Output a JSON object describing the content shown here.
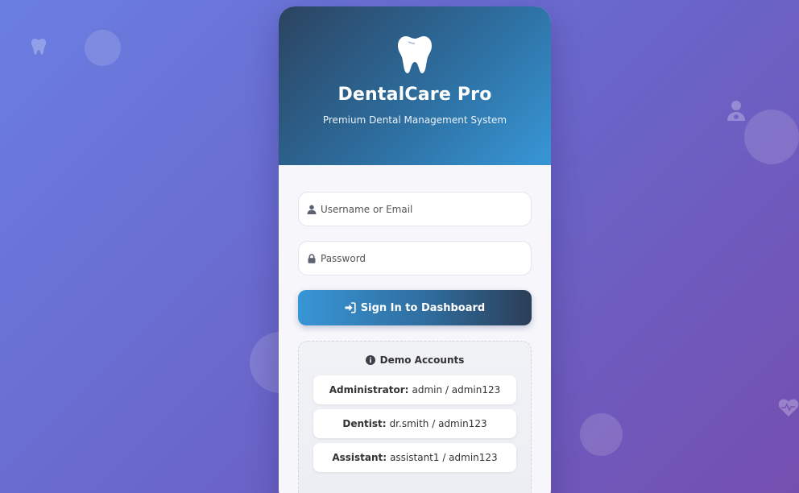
{
  "background": {
    "icons": [
      "tooth-icon",
      "user-doctor-icon",
      "heart-pulse-icon"
    ]
  },
  "header": {
    "logo_icon": "tooth-icon",
    "title": "DentalCare Pro",
    "subtitle": "Premium Dental Management System"
  },
  "form": {
    "username": {
      "placeholder": "Username or Email",
      "icon": "user-icon"
    },
    "password": {
      "placeholder": "Password",
      "icon": "lock-icon"
    },
    "submit": {
      "label": "Sign In to Dashboard",
      "icon": "sign-in-icon"
    }
  },
  "demo": {
    "title": "Demo Accounts",
    "icon": "info-circle-icon",
    "accounts": [
      {
        "role": "Administrator:",
        "credentials": "admin / admin123"
      },
      {
        "role": "Dentist:",
        "credentials": "dr.smith / admin123"
      },
      {
        "role": "Assistant:",
        "credentials": "assistant1 / admin123"
      }
    ]
  },
  "colors": {
    "background_start": "#6a7ee2",
    "background_end": "#744fb0",
    "header_dark": "#2b4360",
    "header_light": "#3796d6",
    "button_start": "#3796d6",
    "button_end": "#2b3e57"
  }
}
